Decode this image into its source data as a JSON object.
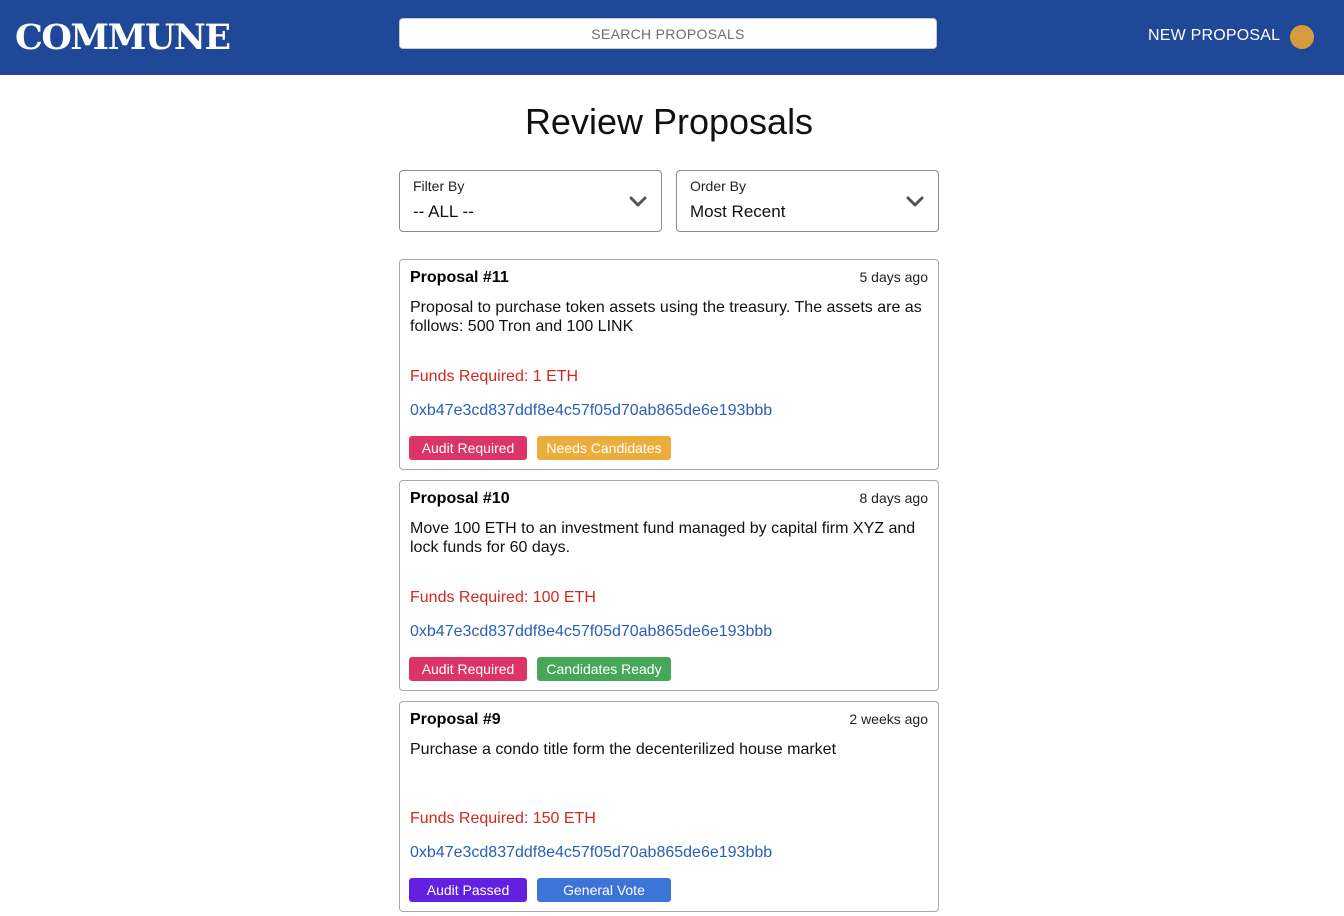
{
  "header": {
    "logo": "COMMUNE",
    "search_placeholder": "SEARCH PROPOSALS",
    "new_proposal_label": "NEW PROPOSAL",
    "avatar_color": "#d79a3e",
    "bar_color": "#1f4898"
  },
  "main": {
    "title": "Review Proposals",
    "filter": {
      "label": "Filter By",
      "value": "-- ALL --"
    },
    "order": {
      "label": "Order By",
      "value": "Most Recent"
    }
  },
  "proposals": [
    {
      "title": "Proposal #11",
      "time": "5 days ago",
      "description": "Proposal to purchase token assets using the treasury. The assets are as follows: 500 Tron and 100 LINK",
      "funds": "Funds Required: 1 ETH",
      "address": "0xb47e3cd837ddf8e4c57f05d70ab865de6e193bbb",
      "badges": [
        {
          "label": "Audit Required",
          "color": "#dd3468"
        },
        {
          "label": "Needs Candidates",
          "color": "#ebad3c"
        }
      ]
    },
    {
      "title": "Proposal #10",
      "time": "8 days ago",
      "description": "Move 100 ETH to an investment fund managed by capital firm XYZ and lock funds for 60 days.",
      "funds": "Funds Required: 100 ETH",
      "address": "0xb47e3cd837ddf8e4c57f05d70ab865de6e193bbb",
      "badges": [
        {
          "label": "Audit Required",
          "color": "#dd3468"
        },
        {
          "label": "Candidates Ready",
          "color": "#46a758"
        }
      ]
    },
    {
      "title": "Proposal #9",
      "time": "2 weeks ago",
      "description": "Purchase a condo title form the decenterilized house market",
      "funds": "Funds Required: 150 ETH",
      "address": "0xb47e3cd837ddf8e4c57f05d70ab865de6e193bbb",
      "badges": [
        {
          "label": "Audit Passed",
          "color": "#6420e0"
        },
        {
          "label": "General Vote",
          "color": "#3c74d8"
        }
      ]
    }
  ]
}
